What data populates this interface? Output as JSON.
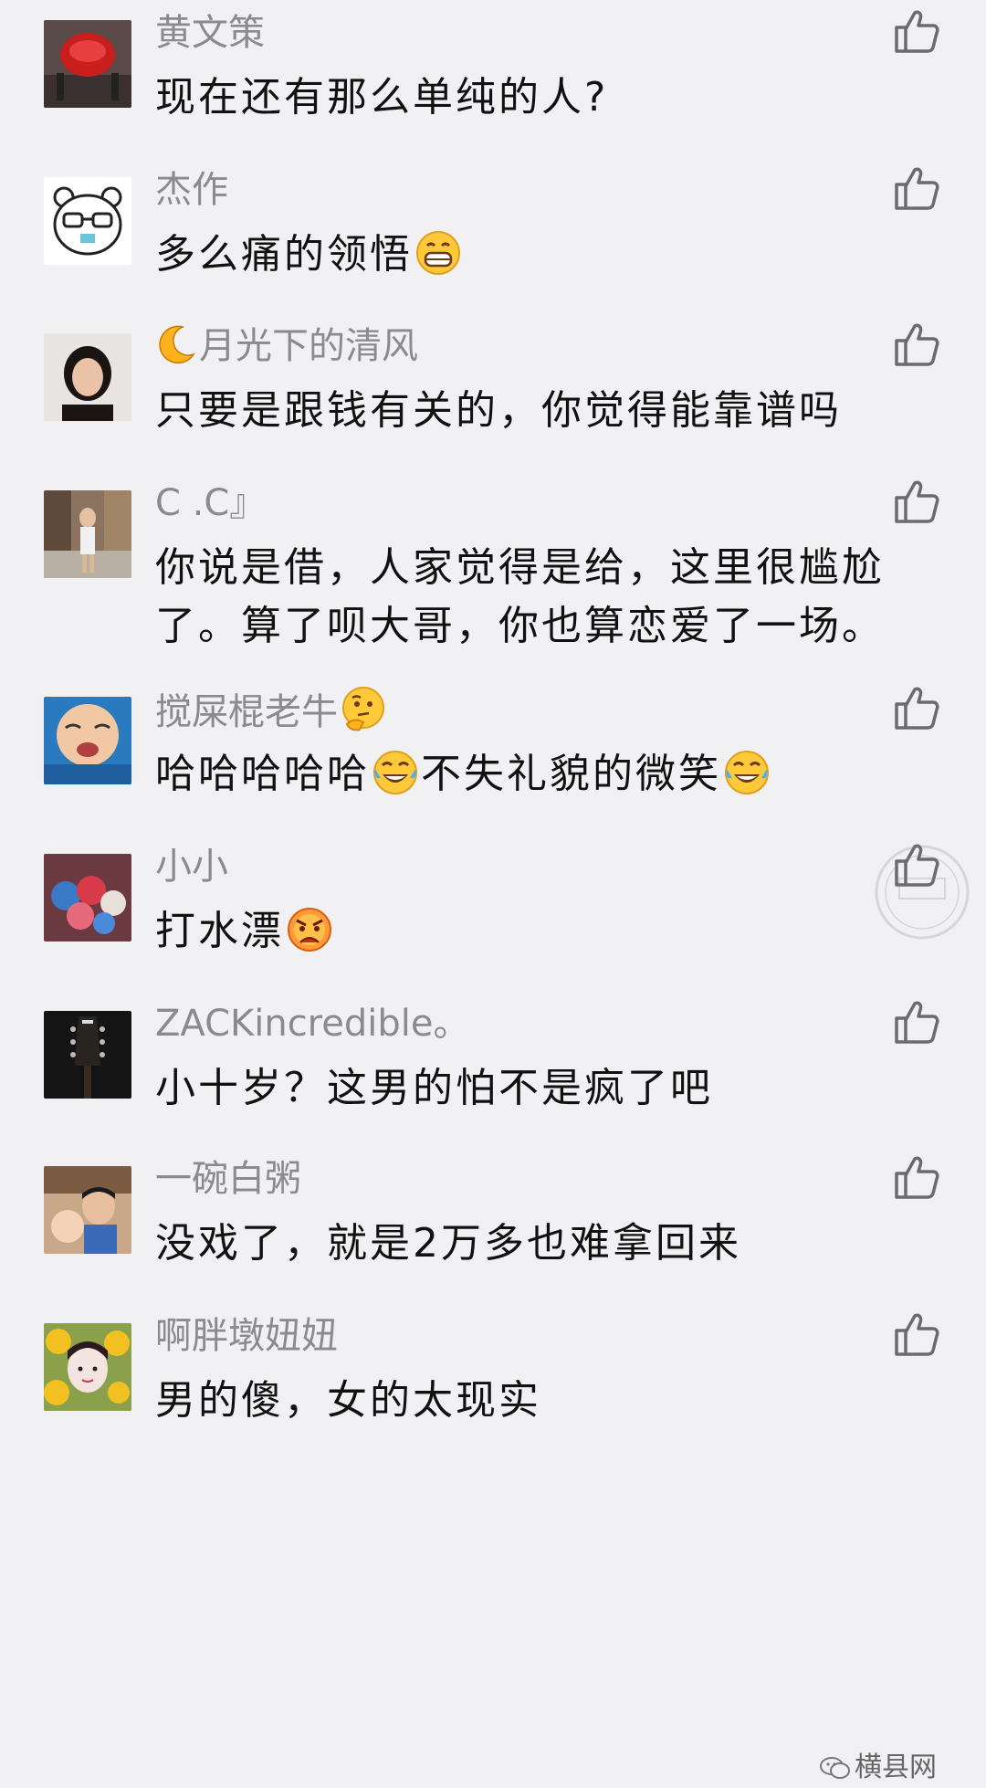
{
  "comments": [
    {
      "name": "黄文策",
      "text": "现在还有那么单纯的人?",
      "avatar_icon": "red-lantern-avatar"
    },
    {
      "name": "杰作",
      "text": "多么痛的领悟",
      "avatar_icon": "cartoon-bear-with-glasses-avatar",
      "emoji_after_text": "grinning-emoji"
    },
    {
      "name": "月光下的清风",
      "name_prefix_icon": "crescent-moon-icon",
      "text": "只要是跟钱有关的，你觉得能靠谱吗",
      "avatar_icon": "woman-portrait-avatar"
    },
    {
      "name": "C .C』",
      "text": "你说是借，人家觉得是给，这里很尴尬了。算了呗大哥，你也算恋爱了一场。",
      "avatar_icon": "street-photo-avatar"
    },
    {
      "name": "搅屎棍老牛",
      "name_suffix_icon": "thinking-emoji",
      "text_parts": [
        "哈哈哈哈哈",
        "不失礼貌的微笑"
      ],
      "avatar_icon": "crying-baby-avatar"
    },
    {
      "name": "小小",
      "text": "打水漂",
      "avatar_icon": "flower-bouquet-avatar",
      "emoji_after_text": "angry-emoji"
    },
    {
      "name": "ZACKincredible。",
      "text": "小十岁？这男的怕不是疯了吧",
      "avatar_icon": "guitar-headstock-avatar"
    },
    {
      "name": "一碗白粥",
      "text": "没戏了，就是2万多也难拿回来",
      "avatar_icon": "father-and-baby-avatar"
    },
    {
      "name": "啊胖墩妞妞",
      "text": "男的傻，女的太现实",
      "avatar_icon": "girl-with-sunflowers-avatar"
    }
  ],
  "watermark": {
    "label": "横县网",
    "icon": "wechat-icon"
  },
  "colors": {
    "background": "#f1f1f3",
    "name": "#8a8a8f",
    "text": "#111111",
    "like_icon": "#6a6a70"
  }
}
